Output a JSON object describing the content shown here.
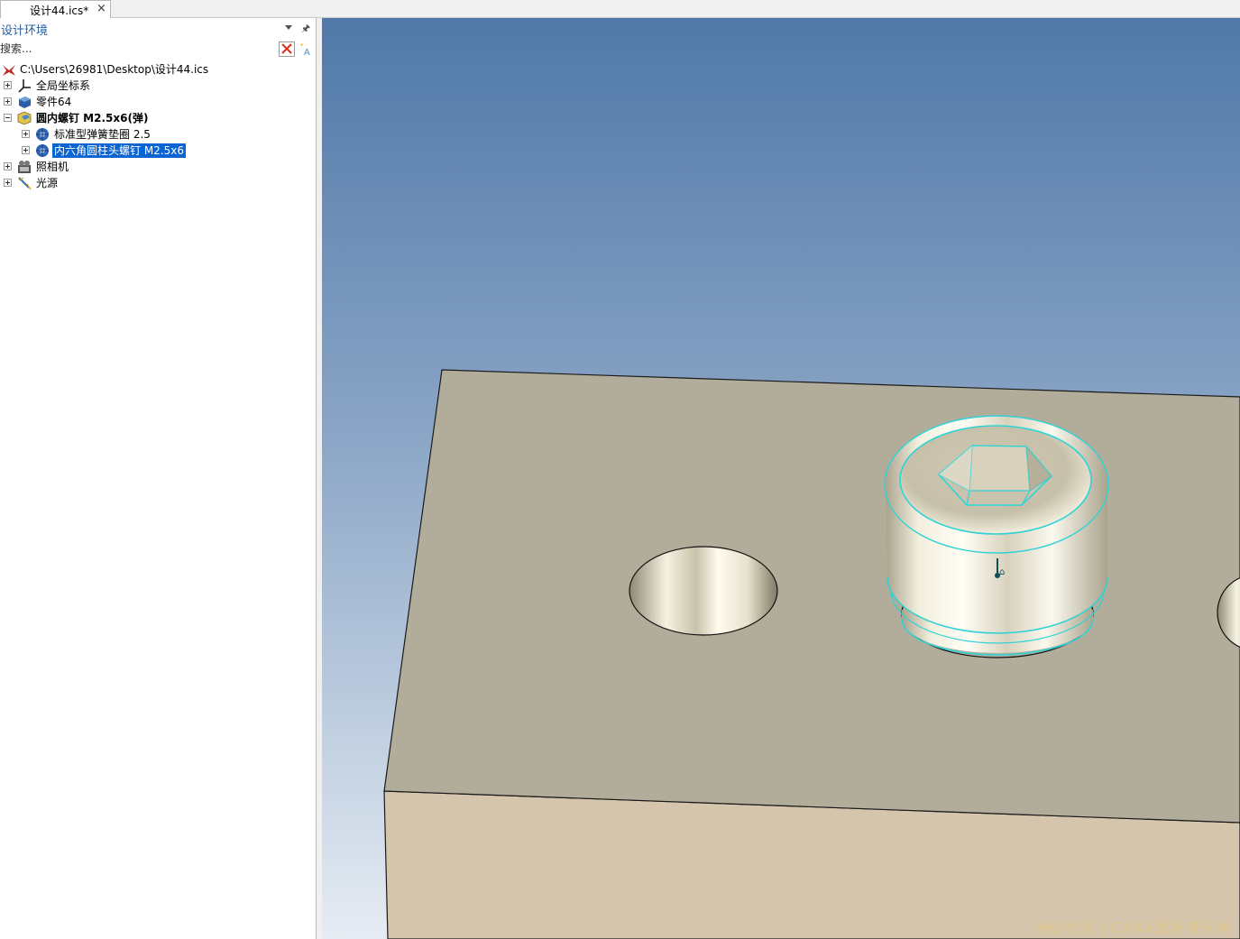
{
  "document_tab": {
    "title": "设计44.ics*",
    "close_glyph": "×"
  },
  "panel": {
    "title": "设计环境",
    "search_placeholder": "搜索...",
    "tree": [
      {
        "label": "C:\\Users\\26981\\Desktop\\设计44.ics",
        "icon": "design-root-icon",
        "level": 0,
        "expander": "none"
      },
      {
        "label": "全局坐标系",
        "icon": "axes-icon",
        "level": 1,
        "expander": "collapsed"
      },
      {
        "label": "零件64",
        "icon": "part-icon",
        "level": 1,
        "expander": "collapsed"
      },
      {
        "label": "圆内螺钉 M2.5x6(弹)",
        "icon": "assembly-icon",
        "level": 1,
        "expander": "expanded",
        "bold": true
      },
      {
        "label": "标准型弹簧垫圈 2.5",
        "icon": "standard-part-icon",
        "level": 2,
        "expander": "collapsed"
      },
      {
        "label": "内六角圆柱头螺钉 M2.5x6",
        "icon": "standard-part-icon",
        "level": 2,
        "expander": "collapsed",
        "selected": true
      },
      {
        "label": "照相机",
        "icon": "camera-icon",
        "level": 1,
        "expander": "collapsed"
      },
      {
        "label": "光源",
        "icon": "light-icon",
        "level": 1,
        "expander": "collapsed"
      }
    ]
  },
  "viewport": {
    "background_top": "#5078a8",
    "background_bottom": "#e6ecf3",
    "block_top_color": "#b2ad9a",
    "block_front_color": "#d4c5ac",
    "highlight_color": "#2fd3d6"
  },
  "watermark": "协议社区 | CAXA爱好者天地"
}
